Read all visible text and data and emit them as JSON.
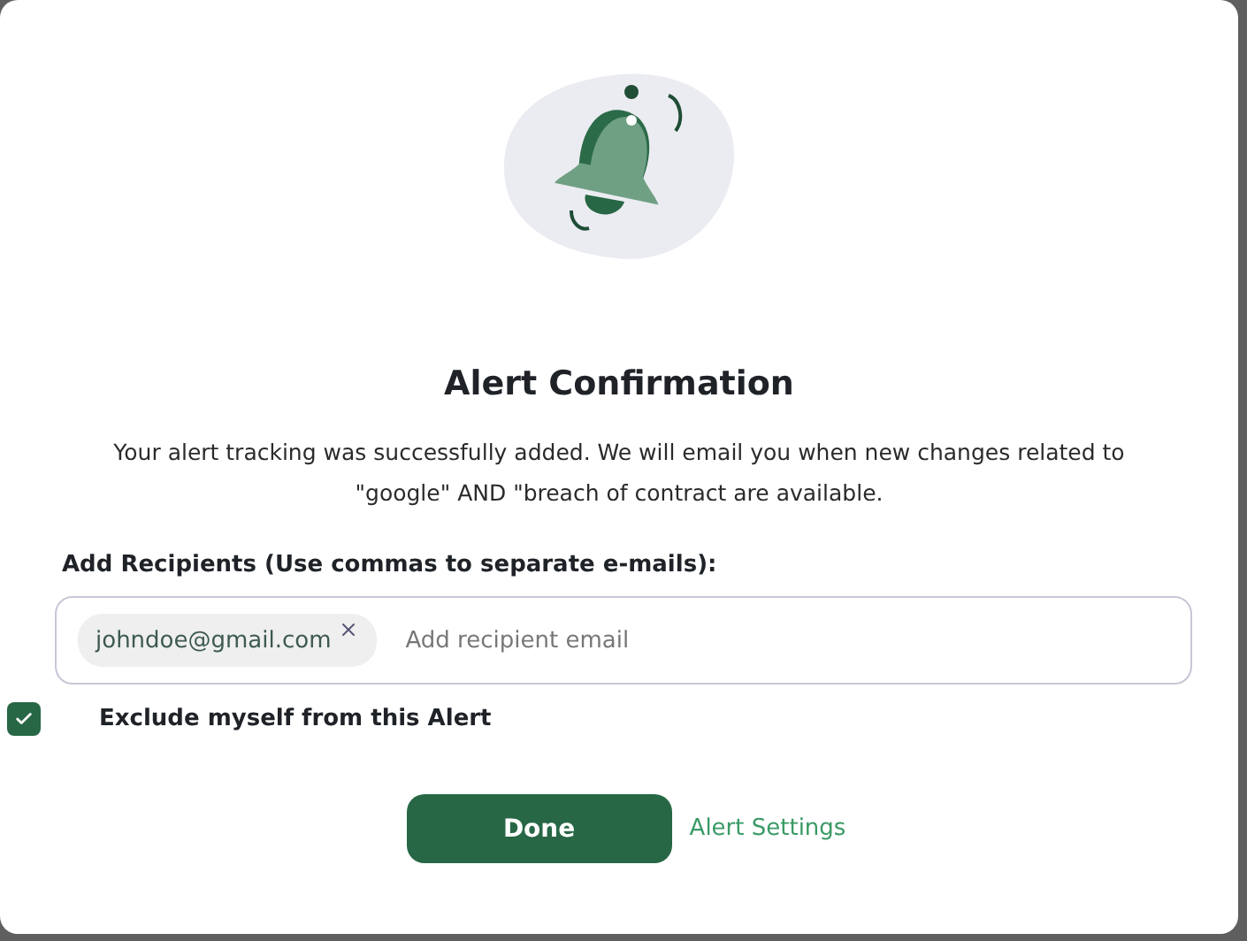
{
  "dialog": {
    "title": "Alert Confirmation",
    "message": "Your alert tracking was successfully added. We will email you when new changes related to \"google\" AND \"breach of contract are available.",
    "recipients_label": "Add Recipients (Use commas to separate e-mails):",
    "recipients": [
      {
        "email": "johndoe@gmail.com"
      }
    ],
    "recipient_field": {
      "placeholder": "Add recipient email"
    },
    "exclude_myself": {
      "label": "Exclude myself from this Alert",
      "checked": true
    },
    "buttons": [
      {
        "label": "Done",
        "kind": "primary"
      },
      {
        "label": "Alert Settings",
        "kind": "link"
      }
    ]
  }
}
